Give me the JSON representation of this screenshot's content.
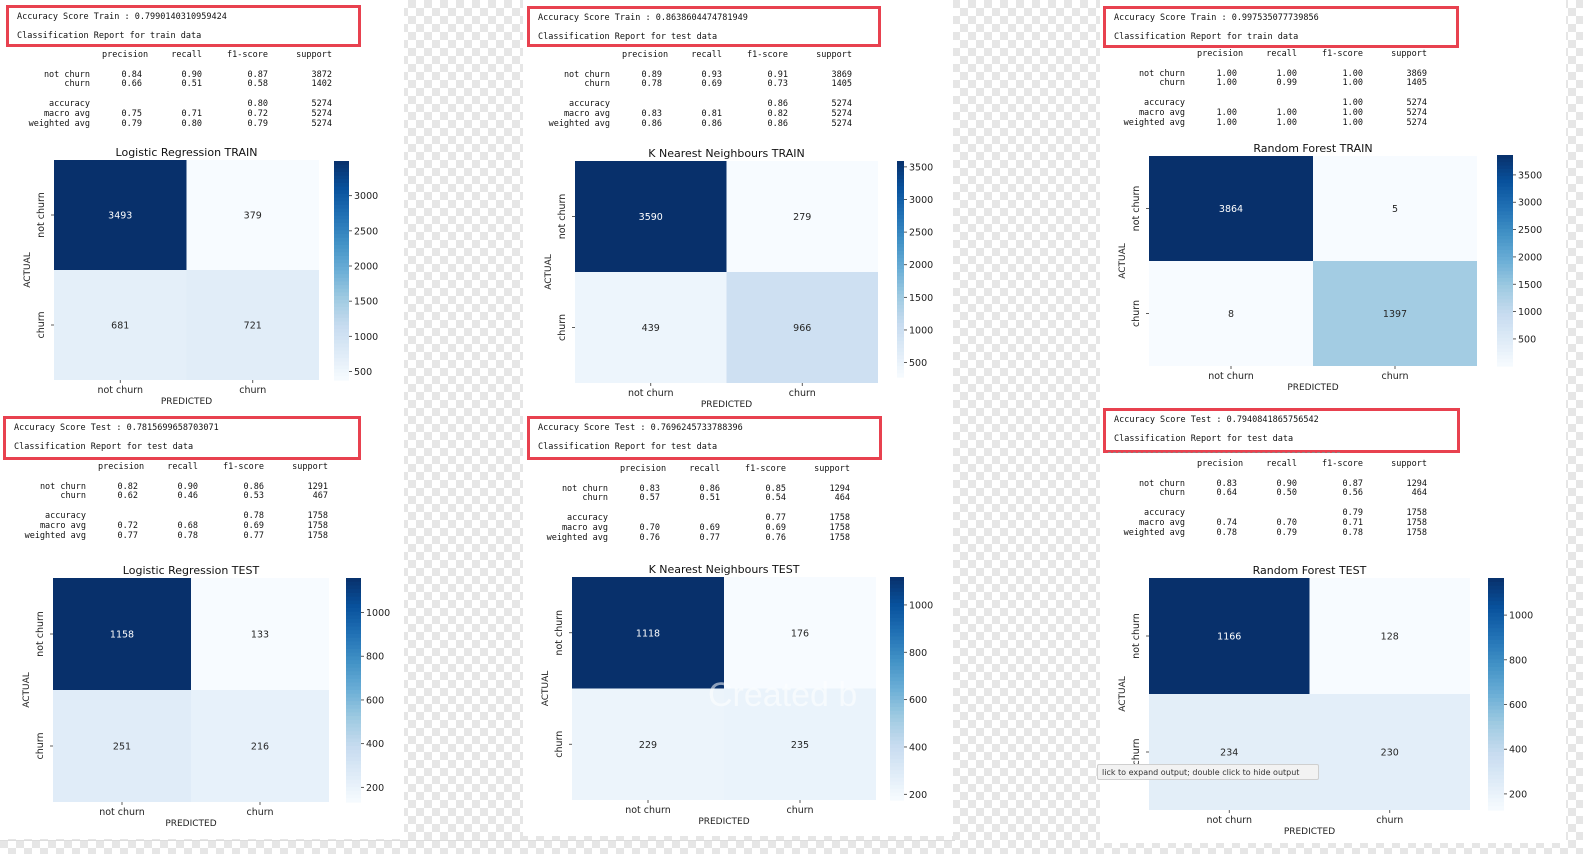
{
  "colors": {
    "highlight_border": "#e8414f",
    "cmap_dark": "#08306b",
    "cmap_light": "#f7fbff"
  },
  "report_headers": [
    "precision",
    "recall",
    "f1-score",
    "support"
  ],
  "report_labels": [
    "not churn",
    "churn",
    "accuracy",
    "macro avg",
    "weighted avg"
  ],
  "panels": [
    {
      "score_line": "Accuracy Score Train : 0.7990140310959424",
      "report_title": "Classification Report for train data",
      "rows": [
        [
          "0.84",
          "0.90",
          "0.87",
          "3872"
        ],
        [
          "0.66",
          "0.51",
          "0.58",
          "1402"
        ],
        [
          "",
          "",
          "0.80",
          "5274"
        ],
        [
          "0.75",
          "0.71",
          "0.72",
          "5274"
        ],
        [
          "0.79",
          "0.80",
          "0.79",
          "5274"
        ]
      ]
    },
    {
      "score_line": "Accuracy Score Train : 0.8638604474781949",
      "report_title": "Classification Report for test data",
      "rows": [
        [
          "0.89",
          "0.93",
          "0.91",
          "3869"
        ],
        [
          "0.78",
          "0.69",
          "0.73",
          "1405"
        ],
        [
          "",
          "",
          "0.86",
          "5274"
        ],
        [
          "0.83",
          "0.81",
          "0.82",
          "5274"
        ],
        [
          "0.86",
          "0.86",
          "0.86",
          "5274"
        ]
      ]
    },
    {
      "score_line": "Accuracy Score Train : 0.997535077739856",
      "report_title": "Classification Report for train data",
      "rows": [
        [
          "1.00",
          "1.00",
          "1.00",
          "3869"
        ],
        [
          "1.00",
          "0.99",
          "1.00",
          "1405"
        ],
        [
          "",
          "",
          "1.00",
          "5274"
        ],
        [
          "1.00",
          "1.00",
          "1.00",
          "5274"
        ],
        [
          "1.00",
          "1.00",
          "1.00",
          "5274"
        ]
      ]
    },
    {
      "score_line": "Accuracy Score Test : 0.7815699658703071",
      "report_title": "Classification Report for test data",
      "rows": [
        [
          "0.82",
          "0.90",
          "0.86",
          "1291"
        ],
        [
          "0.62",
          "0.46",
          "0.53",
          "467"
        ],
        [
          "",
          "",
          "0.78",
          "1758"
        ],
        [
          "0.72",
          "0.68",
          "0.69",
          "1758"
        ],
        [
          "0.77",
          "0.78",
          "0.77",
          "1758"
        ]
      ]
    },
    {
      "score_line": "Accuracy Score Test : 0.7696245733788396",
      "report_title": "Classification Report for test data",
      "rows": [
        [
          "0.83",
          "0.86",
          "0.85",
          "1294"
        ],
        [
          "0.57",
          "0.51",
          "0.54",
          "464"
        ],
        [
          "",
          "",
          "0.77",
          "1758"
        ],
        [
          "0.70",
          "0.69",
          "0.69",
          "1758"
        ],
        [
          "0.76",
          "0.77",
          "0.76",
          "1758"
        ]
      ]
    },
    {
      "score_line": "Accuracy Score Test : 0.7940841865756542",
      "report_title": "Classification Report for test data",
      "rows": [
        [
          "0.83",
          "0.90",
          "0.87",
          "1294"
        ],
        [
          "0.64",
          "0.50",
          "0.56",
          "464"
        ],
        [
          "",
          "",
          "0.79",
          "1758"
        ],
        [
          "0.74",
          "0.70",
          "0.71",
          "1758"
        ],
        [
          "0.78",
          "0.79",
          "0.78",
          "1758"
        ]
      ]
    }
  ],
  "chart_data": [
    {
      "type": "heatmap",
      "title": "Logistic Regression TRAIN",
      "xlabel": "PREDICTED",
      "ylabel": "ACTUAL",
      "x_categories": [
        "not churn",
        "churn"
      ],
      "y_categories": [
        "not churn",
        "churn"
      ],
      "values": [
        [
          3493,
          379
        ],
        [
          681,
          721
        ]
      ],
      "colorbar_ticks": [
        500,
        1000,
        1500,
        2000,
        2500,
        3000
      ],
      "colorbar_range": [
        379,
        3493
      ]
    },
    {
      "type": "heatmap",
      "title": "K Nearest Neighbours TRAIN",
      "xlabel": "PREDICTED",
      "ylabel": "ACTUAL",
      "x_categories": [
        "not churn",
        "churn"
      ],
      "y_categories": [
        "not churn",
        "churn"
      ],
      "values": [
        [
          3590,
          279
        ],
        [
          439,
          966
        ]
      ],
      "colorbar_ticks": [
        500,
        1000,
        1500,
        2000,
        2500,
        3000,
        3500
      ],
      "colorbar_range": [
        279,
        3590
      ]
    },
    {
      "type": "heatmap",
      "title": "Random Forest TRAIN",
      "xlabel": "PREDICTED",
      "ylabel": "ACTUAL",
      "x_categories": [
        "not churn",
        "churn"
      ],
      "y_categories": [
        "not churn",
        "churn"
      ],
      "values": [
        [
          3864,
          5
        ],
        [
          8,
          1397
        ]
      ],
      "colorbar_ticks": [
        500,
        1000,
        1500,
        2000,
        2500,
        3000,
        3500
      ],
      "colorbar_range": [
        5,
        3864
      ]
    },
    {
      "type": "heatmap",
      "title": "Logistic Regression TEST",
      "xlabel": "PREDICTED",
      "ylabel": "ACTUAL",
      "x_categories": [
        "not churn",
        "churn"
      ],
      "y_categories": [
        "not churn",
        "churn"
      ],
      "values": [
        [
          1158,
          133
        ],
        [
          251,
          216
        ]
      ],
      "colorbar_ticks": [
        200,
        400,
        600,
        800,
        1000
      ],
      "colorbar_range": [
        133,
        1158
      ]
    },
    {
      "type": "heatmap",
      "title": "K Nearest Neighbours TEST",
      "xlabel": "PREDICTED",
      "ylabel": "ACTUAL",
      "x_categories": [
        "not churn",
        "churn"
      ],
      "y_categories": [
        "not churn",
        "churn"
      ],
      "values": [
        [
          1118,
          176
        ],
        [
          229,
          235
        ]
      ],
      "colorbar_ticks": [
        200,
        400,
        600,
        800,
        1000
      ],
      "colorbar_range": [
        176,
        1118
      ]
    },
    {
      "type": "heatmap",
      "title": "Random Forest TEST",
      "xlabel": "PREDICTED",
      "ylabel": "ACTUAL",
      "x_categories": [
        "not churn",
        "churn"
      ],
      "y_categories": [
        "not churn",
        "churn"
      ],
      "values": [
        [
          1166,
          128
        ],
        [
          234,
          230
        ]
      ],
      "colorbar_ticks": [
        200,
        400,
        600,
        800,
        1000
      ],
      "colorbar_range": [
        128,
        1166
      ]
    }
  ],
  "tooltip": "lick to expand output; double click to hide output",
  "watermark": "Created b"
}
